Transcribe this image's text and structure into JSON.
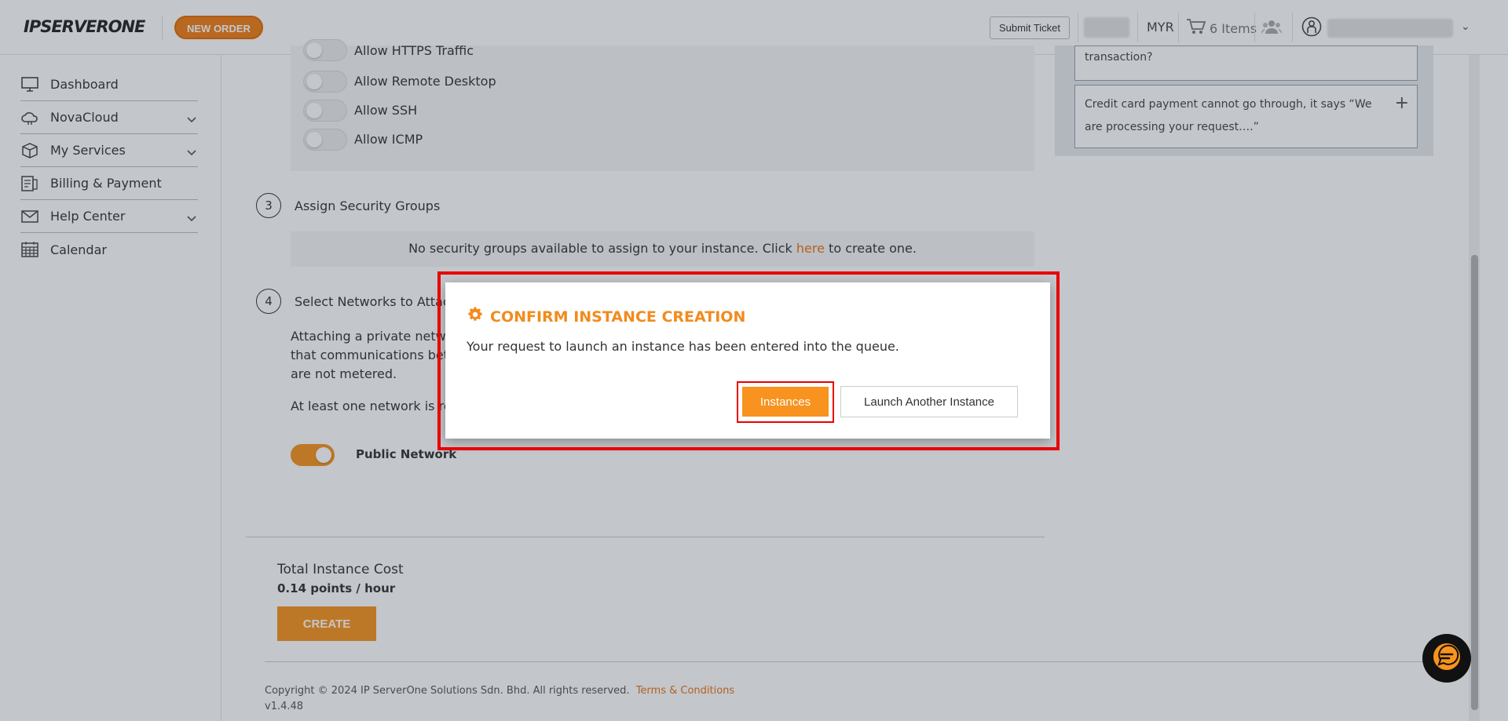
{
  "header": {
    "logo_text": "IPSERVERONE",
    "new_order_label": "NEW ORDER",
    "submit_ticket_label": "Submit Ticket",
    "currency": "MYR",
    "cart_label": "6 Items"
  },
  "sidebar": {
    "items": [
      {
        "label": "Dashboard",
        "icon": "monitor-icon"
      },
      {
        "label": "NovaCloud",
        "icon": "cloud-icon"
      },
      {
        "label": "My Services",
        "icon": "box-icon"
      },
      {
        "label": "Billing & Payment",
        "icon": "invoice-icon"
      },
      {
        "label": "Help Center",
        "icon": "envelope-icon"
      },
      {
        "label": "Calendar",
        "icon": "calendar-icon"
      }
    ]
  },
  "firewall": {
    "partial_top": "Allow HTTPS Traffic",
    "rules": [
      "Allow Remote Desktop",
      "Allow SSH",
      "Allow ICMP"
    ]
  },
  "faq": {
    "item1_tail": "transaction?",
    "item2_line1": "Credit card payment cannot go through, it says “We",
    "item2_line2": "are processing your request….”"
  },
  "step3": {
    "number": "3",
    "title": "Assign Security Groups",
    "message_before": "No security groups available to assign to your instance. Click ",
    "link": "here",
    "message_after": " to create one."
  },
  "step4": {
    "number": "4",
    "title": "Select Networks to Attach",
    "desc_line1": "Attaching a private network",
    "desc_line2": "that communications betwe",
    "desc_line3": "are not metered.",
    "note": "At least one network is req",
    "network_label": "Public Network"
  },
  "cost": {
    "label": "Total Instance Cost",
    "value": "0.14 points / hour",
    "create_label": "CREATE"
  },
  "footer": {
    "copyright": "Copyright © 2024 IP ServerOne Solutions Sdn. Bhd. All rights reserved.",
    "terms": "Terms & Conditions",
    "version": "v1.4.48"
  },
  "modal": {
    "title": "CONFIRM INSTANCE CREATION",
    "message": "Your request to launch an instance has been entered into the queue.",
    "instances_label": "Instances",
    "launch_another_label": "Launch Another Instance"
  },
  "colors": {
    "accent": "#f7931e",
    "highlight": "#e80000"
  }
}
